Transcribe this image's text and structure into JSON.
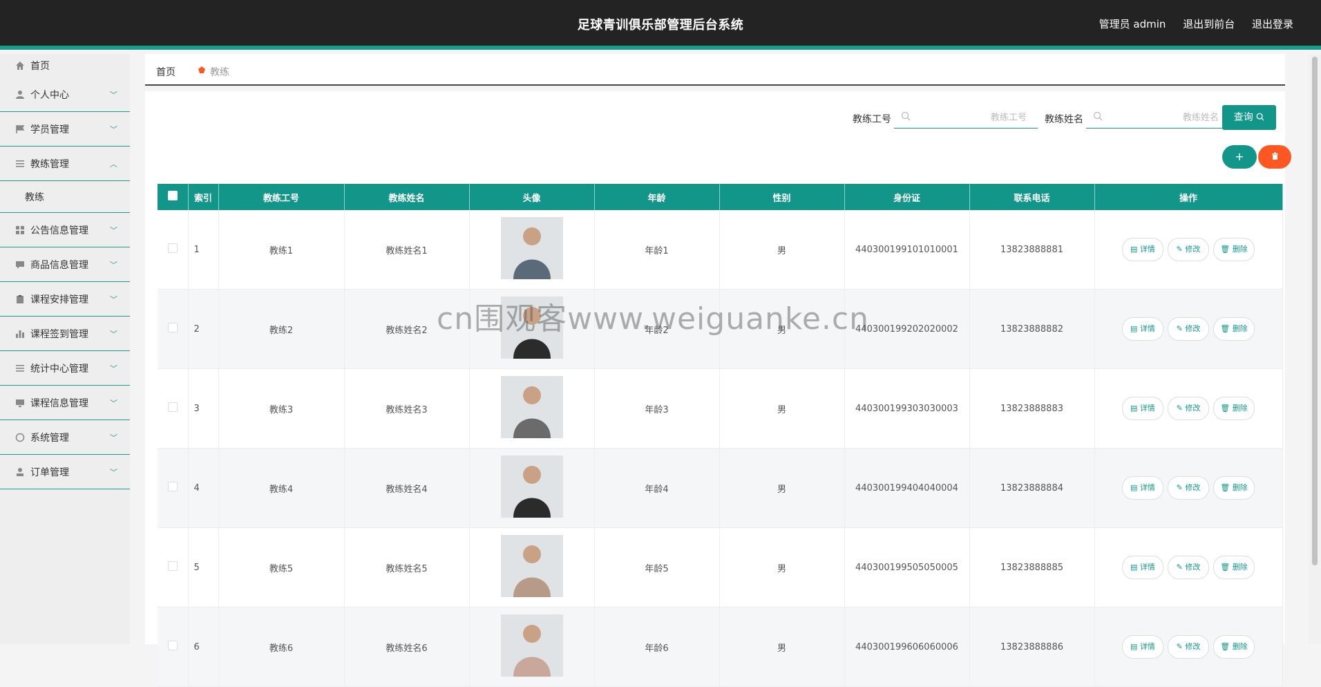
{
  "header": {
    "title": "足球青训俱乐部管理后台系统",
    "admin_label": "管理员 admin",
    "front_label": "退出到前台",
    "logout_label": "退出登录"
  },
  "sidebar": {
    "items": [
      {
        "label": "首页",
        "icon": "home-icon"
      },
      {
        "label": "个人中心",
        "icon": "user-icon"
      },
      {
        "label": "学员管理",
        "icon": "flag-icon"
      },
      {
        "label": "教练管理",
        "icon": "list-icon",
        "expanded": true,
        "sub": "教练"
      },
      {
        "label": "公告信息管理",
        "icon": "grid-icon"
      },
      {
        "label": "商品信息管理",
        "icon": "chat-icon"
      },
      {
        "label": "课程安排管理",
        "icon": "clipboard-icon"
      },
      {
        "label": "课程签到管理",
        "icon": "bar-chart-icon"
      },
      {
        "label": "统计中心管理",
        "icon": "list-icon"
      },
      {
        "label": "课程信息管理",
        "icon": "monitor-icon"
      },
      {
        "label": "系统管理",
        "icon": "compass-icon"
      },
      {
        "label": "订单管理",
        "icon": "person-icon"
      }
    ]
  },
  "breadcrumb": {
    "home": "首页",
    "current": "教练"
  },
  "search": {
    "id_label": "教练工号",
    "id_placeholder": "教练工号",
    "name_label": "教练姓名",
    "name_placeholder": "教练姓名",
    "query_label": "查询"
  },
  "actions": {
    "add_label": "+"
  },
  "table": {
    "headers": [
      "索引",
      "教练工号",
      "教练姓名",
      "头像",
      "年龄",
      "性别",
      "身份证",
      "联系电话",
      "操作"
    ],
    "row_actions": {
      "detail": "详情",
      "edit": "修改",
      "delete": "删除"
    },
    "rows": [
      {
        "index": "1",
        "code": "教练1",
        "name": "教练姓名1",
        "age": "年龄1",
        "gender": "男",
        "id_card": "440300199101010001",
        "phone": "13823888881",
        "avatar_color": "#5a6a78"
      },
      {
        "index": "2",
        "code": "教练2",
        "name": "教练姓名2",
        "age": "年龄2",
        "gender": "男",
        "id_card": "440300199202020002",
        "phone": "13823888882",
        "avatar_color": "#2b2b2b"
      },
      {
        "index": "3",
        "code": "教练3",
        "name": "教练姓名3",
        "age": "年龄3",
        "gender": "男",
        "id_card": "440300199303030003",
        "phone": "13823888883",
        "avatar_color": "#6b6b6b"
      },
      {
        "index": "4",
        "code": "教练4",
        "name": "教练姓名4",
        "age": "年龄4",
        "gender": "男",
        "id_card": "440300199404040004",
        "phone": "13823888884",
        "avatar_color": "#2b2b2b"
      },
      {
        "index": "5",
        "code": "教练5",
        "name": "教练姓名5",
        "age": "年龄5",
        "gender": "男",
        "id_card": "440300199505050005",
        "phone": "13823888885",
        "avatar_color": "#b89a88"
      },
      {
        "index": "6",
        "code": "教练6",
        "name": "教练姓名6",
        "age": "年龄6",
        "gender": "男",
        "id_card": "440300199606060006",
        "phone": "13823888886",
        "avatar_color": "#c9a79a"
      }
    ]
  },
  "watermark": "cn围观客www.weiguanke.cn",
  "colors": {
    "primary": "#13968a",
    "danger": "#ff5722",
    "header_bg": "#232323"
  }
}
